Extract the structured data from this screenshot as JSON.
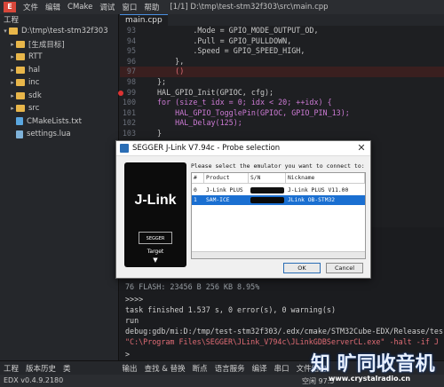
{
  "menubar": {
    "items": [
      "文件",
      "编辑",
      "CMake",
      "调试",
      "窗口",
      "帮助"
    ],
    "title": "[1/1] D:\\tmp\\test-stm32f303\\src\\main.cpp"
  },
  "sidebar": {
    "header": "工程",
    "items": [
      {
        "label": "D:\\tmp\\test-stm32f303",
        "kind": "folder",
        "arrow": "▾"
      },
      {
        "label": "[生成目标]",
        "kind": "folder",
        "arrow": "▸"
      },
      {
        "label": "RTT",
        "kind": "folder",
        "arrow": "▸"
      },
      {
        "label": "hal",
        "kind": "folder",
        "arrow": "▸"
      },
      {
        "label": "inc",
        "kind": "folder",
        "arrow": "▸"
      },
      {
        "label": "sdk",
        "kind": "folder",
        "arrow": "▸"
      },
      {
        "label": "src",
        "kind": "folder",
        "arrow": "▸"
      },
      {
        "label": "CMakeLists.txt",
        "kind": "file",
        "arrow": ""
      },
      {
        "label": "settings.lua",
        "kind": "file",
        "arrow": ""
      }
    ]
  },
  "editor": {
    "tab": "main.cpp",
    "lines": [
      {
        "n": "93",
        "t": "        .Mode = GPIO_MODE_OUTPUT_OD,"
      },
      {
        "n": "94",
        "t": "        .Pull = GPIO_PULLDOWN,"
      },
      {
        "n": "95",
        "t": "        .Speed = GPIO_SPEED_HIGH,"
      },
      {
        "n": "96",
        "t": "    },"
      },
      {
        "n": "97",
        "t": "    ()"
      },
      {
        "n": "98",
        "t": "};"
      },
      {
        "n": "99",
        "t": "HAL_GPIO_Init(GPIOC, cfg);"
      },
      {
        "n": "100",
        "t": "for (size_t idx = 0; idx < 20; ++idx) {"
      },
      {
        "n": "101",
        "t": "    HAL_GPIO_TogglePin(GPIOC, GPIO_PIN_13);"
      },
      {
        "n": "102",
        "t": "    HAL_Delay(125);"
      },
      {
        "n": "103",
        "t": "}"
      }
    ]
  },
  "output": {
    "lines": [
      "                                          e-w64-i686-arm-n",
      "76        FLASH:       23456 B        256 KB       8.95%",
      ">>>>",
      "task finished 1.537 s, 0 error(s), 0 warning(s)",
      "run",
      "debug:gdb/mi:D:/tmp/test-stm32f303/.edx/cmake/STM32Cube-EDX/Release/tes",
      "\"C:\\Program Files\\SEGGER\\JLink_V794c\\JLinkGDBServerCL.exe\" -halt -if J",
      ">"
    ]
  },
  "bottom_tabs": {
    "left": [
      "工程",
      "版本历史",
      "类"
    ],
    "right": [
      "输出",
      "查找 & 替换",
      "断点",
      "语言服务",
      "编译",
      "串口",
      "文件结构"
    ]
  },
  "status": {
    "version": "EDX v0.4.9.2180",
    "right": "空闲  97:5"
  },
  "watermark": "知 旷同收音机",
  "watermark_url": "www.crystalradio.cn",
  "dialog": {
    "title": "SEGGER J-Link V7.94c - Probe selection",
    "close": "✕",
    "prompt": "Please select the emulator you want to connect to:",
    "logo_text": "J-Link",
    "segger": "SEGGER",
    "target": "Target",
    "headers": [
      "#",
      "Product",
      "S/N",
      "Nickname"
    ],
    "rows": [
      {
        "idx": "0",
        "product": "J-Link PLUS",
        "nickname": "J-Link PLUS V11.00",
        "selected": false
      },
      {
        "idx": "1",
        "product": "SAM-ICE",
        "nickname": "JLink OB-STM32",
        "selected": true
      }
    ],
    "ok": "OK",
    "cancel": "Cancel"
  }
}
